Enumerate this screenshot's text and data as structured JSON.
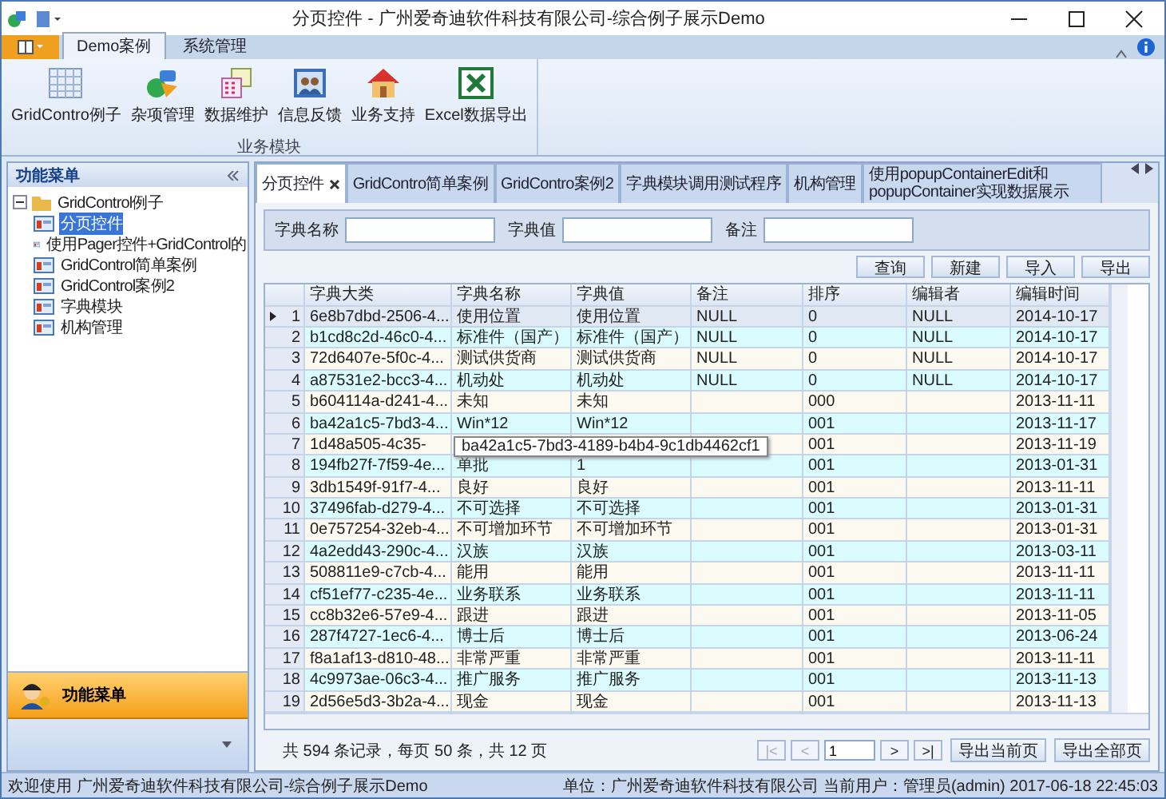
{
  "window": {
    "title": "分页控件 - 广州爱奇迪软件科技有限公司-综合例子展示Demo"
  },
  "ribbon": {
    "tabs": [
      {
        "label": "Demo案例",
        "selected": true
      },
      {
        "label": "系统管理",
        "selected": false
      }
    ],
    "groups": [
      {
        "label": "业务模块",
        "items": [
          {
            "label": "GridContro例子"
          },
          {
            "label": "杂项管理"
          },
          {
            "label": "数据维护"
          },
          {
            "label": "信息反馈"
          },
          {
            "label": "业务支持"
          },
          {
            "label": "Excel数据导出"
          }
        ]
      }
    ]
  },
  "nav_panel": {
    "title": "功能菜单",
    "tree": [
      {
        "label": "GridControl例子",
        "expanded": true,
        "children": [
          {
            "label": "分页控件",
            "selected": true
          },
          {
            "label": "使用Pager控件+GridControl的",
            "selected": false
          },
          {
            "label": "GridControl简单案例",
            "selected": false
          },
          {
            "label": "GridControl案例2",
            "selected": false
          },
          {
            "label": "字典模块",
            "selected": false
          },
          {
            "label": "机构管理",
            "selected": false
          }
        ]
      }
    ],
    "bottom_button": "功能菜单"
  },
  "doc_tabs": [
    {
      "label": "分页控件",
      "selected": true
    },
    {
      "label": "GridContro简单案例",
      "selected": false
    },
    {
      "label": "GridContro案例2",
      "selected": false
    },
    {
      "label": "字典模块调用测试程序",
      "selected": false
    },
    {
      "label": "机构管理",
      "selected": false
    },
    {
      "label": "使用popupContainerEdit和popupContainer实现数据展示",
      "selected": false
    }
  ],
  "filter": {
    "fields": [
      {
        "label": "字典名称"
      },
      {
        "label": "字典值"
      },
      {
        "label": "备注"
      }
    ]
  },
  "buttons": [
    "查询",
    "新建",
    "导入",
    "导出"
  ],
  "table": {
    "columns": [
      "字典大类",
      "字典名称",
      "字典值",
      "备注",
      "排序",
      "编辑者",
      "编辑时间"
    ],
    "rows": [
      {
        "number": "1",
        "current": true,
        "cells": [
          "6e8b7dbd-2506-4...",
          "使用位置",
          "使用位置",
          "NULL",
          "0",
          "NULL",
          "2014-10-17"
        ]
      },
      {
        "number": "2",
        "current": false,
        "cells": [
          "b1cd8c2d-46c0-4...",
          "标准件（国产）",
          "标准件（国产）",
          "NULL",
          "0",
          "NULL",
          "2014-10-17"
        ]
      },
      {
        "number": "3",
        "current": false,
        "cells": [
          "72d6407e-5f0c-4...",
          "测试供货商",
          "测试供货商",
          "NULL",
          "0",
          "NULL",
          "2014-10-17"
        ]
      },
      {
        "number": "4",
        "current": false,
        "cells": [
          "a87531e2-bcc3-4...",
          "机动处",
          "机动处",
          "NULL",
          "0",
          "NULL",
          "2014-10-17"
        ]
      },
      {
        "number": "5",
        "current": false,
        "cells": [
          "b604114a-d241-4...",
          "未知",
          "未知",
          "",
          "000",
          "",
          "2013-11-11"
        ]
      },
      {
        "number": "6",
        "current": false,
        "cells": [
          "ba42a1c5-7bd3-4...",
          "Win*12",
          "Win*12",
          "",
          "001",
          "",
          "2013-11-17"
        ]
      },
      {
        "number": "7",
        "current": false,
        "cells": [
          "1d48a505-4c35-",
          "",
          "",
          "",
          "001",
          "",
          "2013-11-19"
        ]
      },
      {
        "number": "8",
        "current": false,
        "cells": [
          "194fb27f-7f59-4e...",
          "单批",
          "1",
          "",
          "001",
          "",
          "2013-01-31"
        ]
      },
      {
        "number": "9",
        "current": false,
        "cells": [
          "3db1549f-91f7-4...",
          "良好",
          "良好",
          "",
          "001",
          "",
          "2013-11-11"
        ]
      },
      {
        "number": "10",
        "current": false,
        "cells": [
          "37496fab-d279-4...",
          "不可选择",
          "不可选择",
          "",
          "001",
          "",
          "2013-01-31"
        ]
      },
      {
        "number": "11",
        "current": false,
        "cells": [
          "0e757254-32eb-4...",
          "不可增加环节",
          "不可增加环节",
          "",
          "001",
          "",
          "2013-01-31"
        ]
      },
      {
        "number": "12",
        "current": false,
        "cells": [
          "4a2edd43-290c-4...",
          "汉族",
          "汉族",
          "",
          "001",
          "",
          "2013-03-11"
        ]
      },
      {
        "number": "13",
        "current": false,
        "cells": [
          "508811e9-c7cb-4...",
          "能用",
          "能用",
          "",
          "001",
          "",
          "2013-11-11"
        ]
      },
      {
        "number": "14",
        "current": false,
        "cells": [
          "cf51ef77-c235-4e...",
          "业务联系",
          "业务联系",
          "",
          "001",
          "",
          "2013-11-11"
        ]
      },
      {
        "number": "15",
        "current": false,
        "cells": [
          "cc8b32e6-57e9-4...",
          "跟进",
          "跟进",
          "",
          "001",
          "",
          "2013-11-05"
        ]
      },
      {
        "number": "16",
        "current": false,
        "cells": [
          "287f4727-1ec6-4...",
          "博士后",
          "博士后",
          "",
          "001",
          "",
          "2013-06-24"
        ]
      },
      {
        "number": "17",
        "current": false,
        "cells": [
          "f8a1af13-d810-48...",
          "非常严重",
          "非常严重",
          "",
          "001",
          "",
          "2013-11-11"
        ]
      },
      {
        "number": "18",
        "current": false,
        "cells": [
          "4c9973ae-06c3-4...",
          "推广服务",
          "推广服务",
          "",
          "001",
          "",
          "2013-11-13"
        ]
      },
      {
        "number": "19",
        "current": false,
        "cells": [
          "2d56e5d3-3b2a-4...",
          "现金",
          "现金",
          "",
          "001",
          "",
          "2013-11-13"
        ]
      }
    ],
    "tooltip": "ba42a1c5-7bd3-4189-b4b4-9c1db4462cf1"
  },
  "pager": {
    "summary": "共 594 条记录，每页 50 条，共 12 页",
    "page": "1",
    "nav_buttons": [
      {
        "label": "|<",
        "disabled": true
      },
      {
        "label": "<",
        "disabled": true
      },
      {
        "label": ">",
        "disabled": false
      },
      {
        "label": ">|",
        "disabled": false
      }
    ],
    "export_buttons": [
      "导出当前页",
      "导出全部页"
    ]
  },
  "status_bar": {
    "left": "欢迎使用 广州爱奇迪软件科技有限公司-综合例子展示Demo",
    "right": "单位：广州爱奇迪软件科技有限公司 当前用户：管理员(admin)  2017-06-18 22:45:03"
  }
}
